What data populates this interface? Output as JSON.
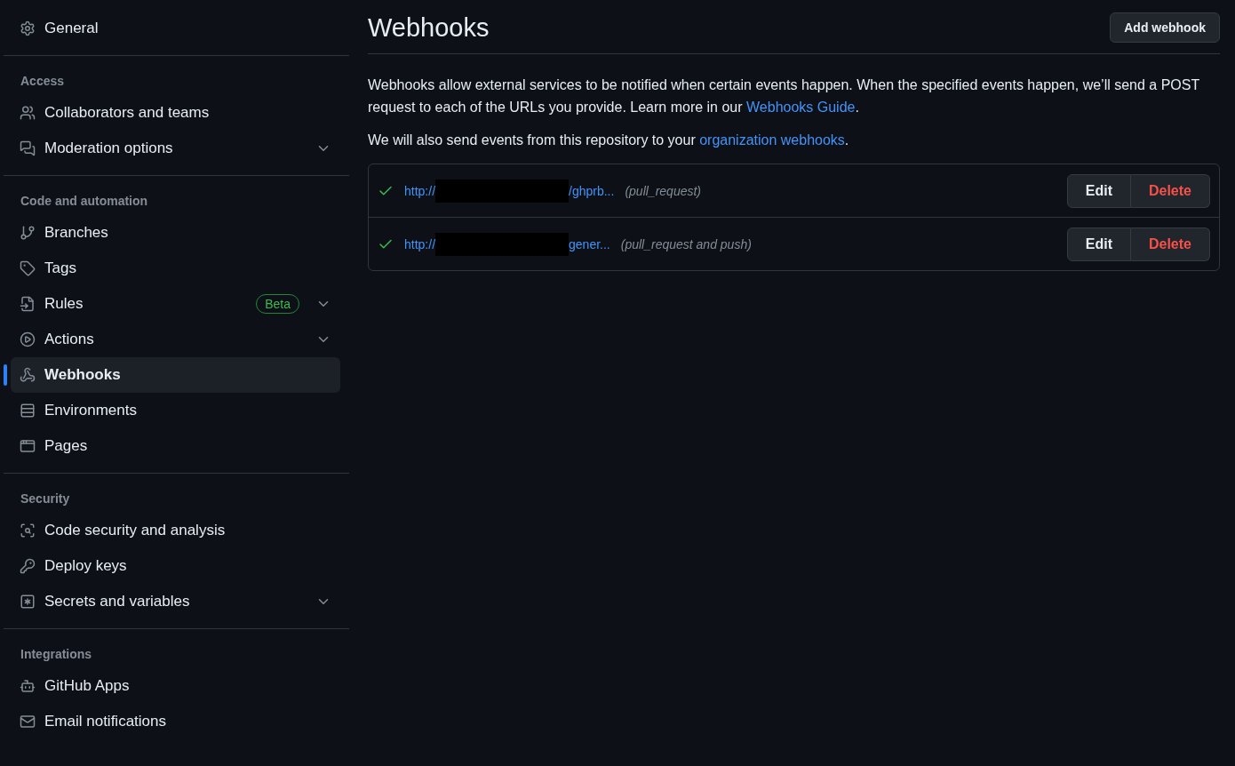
{
  "sidebar": {
    "sections": [
      {
        "items": [
          {
            "label": "General",
            "selected": false,
            "expandable": false
          }
        ]
      },
      {
        "title": "Access",
        "items": [
          {
            "label": "Collaborators and teams",
            "selected": false,
            "expandable": false
          },
          {
            "label": "Moderation options",
            "selected": false,
            "expandable": true
          }
        ]
      },
      {
        "title": "Code and automation",
        "items": [
          {
            "label": "Branches",
            "selected": false,
            "expandable": false
          },
          {
            "label": "Tags",
            "selected": false,
            "expandable": false
          },
          {
            "label": "Rules",
            "selected": false,
            "expandable": true,
            "badge": "Beta"
          },
          {
            "label": "Actions",
            "selected": false,
            "expandable": true
          },
          {
            "label": "Webhooks",
            "selected": true,
            "expandable": false
          },
          {
            "label": "Environments",
            "selected": false,
            "expandable": false
          },
          {
            "label": "Pages",
            "selected": false,
            "expandable": false
          }
        ]
      },
      {
        "title": "Security",
        "items": [
          {
            "label": "Code security and analysis",
            "selected": false,
            "expandable": false
          },
          {
            "label": "Deploy keys",
            "selected": false,
            "expandable": false
          },
          {
            "label": "Secrets and variables",
            "selected": false,
            "expandable": true
          }
        ]
      },
      {
        "title": "Integrations",
        "items": [
          {
            "label": "GitHub Apps",
            "selected": false,
            "expandable": false
          },
          {
            "label": "Email notifications",
            "selected": false,
            "expandable": false
          }
        ]
      }
    ]
  },
  "header": {
    "title": "Webhooks",
    "button": "Add webhook"
  },
  "intro": {
    "text": "Webhooks allow external services to be notified when certain events happen. When the specified events happen, we’ll send a POST request to each of the URLs you provide. Learn more in our ",
    "link": "Webhooks Guide",
    "after": "."
  },
  "note": {
    "text": "We will also send events from this repository to your ",
    "link": "organization webhooks",
    "after": "."
  },
  "webhooks": [
    {
      "ok": true,
      "url_start": "http://",
      "redacted": true,
      "url_end": "/ghprb...",
      "events": "(pull_request)",
      "edit": "Edit",
      "delete": "Delete"
    },
    {
      "ok": true,
      "url_start": "http://",
      "redacted": true,
      "url_end": "gener...",
      "events": "(pull_request and push)",
      "edit": "Edit",
      "delete": "Delete"
    }
  ]
}
